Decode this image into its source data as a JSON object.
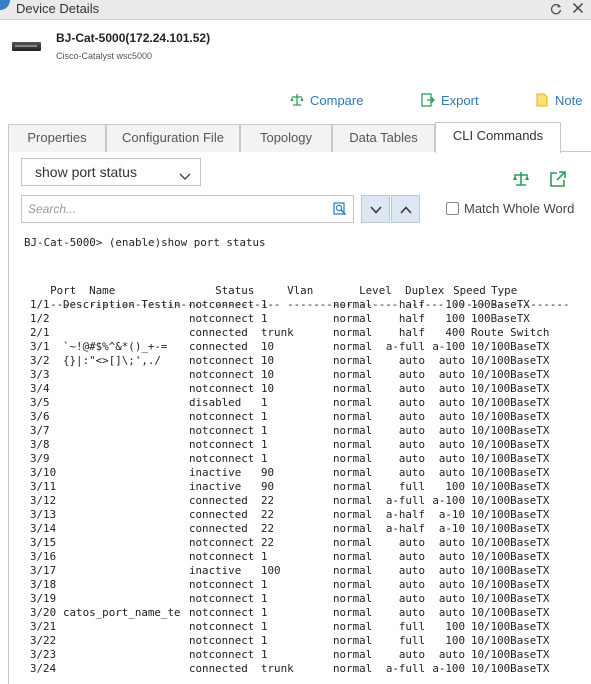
{
  "window": {
    "title": "Device Details",
    "restore_icon": "restore-icon",
    "close_icon": "close-icon"
  },
  "device": {
    "name": "BJ-Cat-5000(172.24.101.52)",
    "model": "Cisco-Catalyst wsc5000",
    "icon": "switch-device-icon"
  },
  "actions": {
    "compare": "Compare",
    "export": "Export",
    "note": "Note"
  },
  "colors": {
    "accent": "#2a7ab8",
    "green": "#2e9e5b",
    "note_yellow": "#f2c530"
  },
  "tabs": [
    {
      "label": "Properties",
      "active": false
    },
    {
      "label": "Configuration File",
      "active": false
    },
    {
      "label": "Topology",
      "active": false
    },
    {
      "label": "Data Tables",
      "active": false
    },
    {
      "label": "CLI Commands",
      "active": true
    }
  ],
  "command_select": {
    "value": "show port status"
  },
  "search": {
    "placeholder": "Search...",
    "value": ""
  },
  "match_whole_word": {
    "label": "Match Whole Word",
    "checked": false
  },
  "cli": {
    "prompt": "BJ-Cat-5000> (enable)show port status",
    "headers": [
      "Port",
      "Name",
      "Status",
      "Vlan",
      "Level",
      "Duplex",
      "Speed",
      "Type"
    ],
    "separators": [
      "-----",
      "------------------",
      "----------",
      "----------",
      "------",
      "------",
      "-----",
      "------------"
    ],
    "rows": [
      [
        "1/1",
        "Description Testin",
        "notconnect",
        "1",
        "normal",
        "half",
        "100",
        "100BaseTX"
      ],
      [
        "1/2",
        "",
        "notconnect",
        "1",
        "normal",
        "half",
        "100",
        "100BaseTX"
      ],
      [
        "2/1",
        "",
        "connected",
        "trunk",
        "normal",
        "half",
        "400",
        "Route Switch"
      ],
      [
        "3/1",
        "`~!@#$%^&*()_+-=",
        "connected",
        "10",
        "normal",
        "a-full",
        "a-100",
        "10/100BaseTX"
      ],
      [
        "3/2",
        "{}|:\"<>[]\\;',./",
        "notconnect",
        "10",
        "normal",
        "auto",
        "auto",
        "10/100BaseTX"
      ],
      [
        "3/3",
        "",
        "notconnect",
        "10",
        "normal",
        "auto",
        "auto",
        "10/100BaseTX"
      ],
      [
        "3/4",
        "",
        "notconnect",
        "10",
        "normal",
        "auto",
        "auto",
        "10/100BaseTX"
      ],
      [
        "3/5",
        "",
        "disabled",
        "1",
        "normal",
        "auto",
        "auto",
        "10/100BaseTX"
      ],
      [
        "3/6",
        "",
        "notconnect",
        "1",
        "normal",
        "auto",
        "auto",
        "10/100BaseTX"
      ],
      [
        "3/7",
        "",
        "notconnect",
        "1",
        "normal",
        "auto",
        "auto",
        "10/100BaseTX"
      ],
      [
        "3/8",
        "",
        "notconnect",
        "1",
        "normal",
        "auto",
        "auto",
        "10/100BaseTX"
      ],
      [
        "3/9",
        "",
        "notconnect",
        "1",
        "normal",
        "auto",
        "auto",
        "10/100BaseTX"
      ],
      [
        "3/10",
        "",
        "inactive",
        "90",
        "normal",
        "auto",
        "auto",
        "10/100BaseTX"
      ],
      [
        "3/11",
        "",
        "inactive",
        "90",
        "normal",
        "full",
        "100",
        "10/100BaseTX"
      ],
      [
        "3/12",
        "",
        "connected",
        "22",
        "normal",
        "a-full",
        "a-100",
        "10/100BaseTX"
      ],
      [
        "3/13",
        "",
        "connected",
        "22",
        "normal",
        "a-half",
        "a-10",
        "10/100BaseTX"
      ],
      [
        "3/14",
        "",
        "connected",
        "22",
        "normal",
        "a-half",
        "a-10",
        "10/100BaseTX"
      ],
      [
        "3/15",
        "",
        "notconnect",
        "22",
        "normal",
        "auto",
        "auto",
        "10/100BaseTX"
      ],
      [
        "3/16",
        "",
        "notconnect",
        "1",
        "normal",
        "auto",
        "auto",
        "10/100BaseTX"
      ],
      [
        "3/17",
        "",
        "inactive",
        "100",
        "normal",
        "auto",
        "auto",
        "10/100BaseTX"
      ],
      [
        "3/18",
        "",
        "notconnect",
        "1",
        "normal",
        "auto",
        "auto",
        "10/100BaseTX"
      ],
      [
        "3/19",
        "",
        "notconnect",
        "1",
        "normal",
        "auto",
        "auto",
        "10/100BaseTX"
      ],
      [
        "3/20",
        "catos_port_name_te",
        "notconnect",
        "1",
        "normal",
        "auto",
        "auto",
        "10/100BaseTX"
      ],
      [
        "3/21",
        "",
        "notconnect",
        "1",
        "normal",
        "full",
        "100",
        "10/100BaseTX"
      ],
      [
        "3/22",
        "",
        "notconnect",
        "1",
        "normal",
        "full",
        "100",
        "10/100BaseTX"
      ],
      [
        "3/23",
        "",
        "notconnect",
        "1",
        "normal",
        "auto",
        "auto",
        "10/100BaseTX"
      ],
      [
        "3/24",
        "",
        "connected",
        "trunk",
        "normal",
        "a-full",
        "a-100",
        "10/100BaseTX"
      ]
    ]
  }
}
